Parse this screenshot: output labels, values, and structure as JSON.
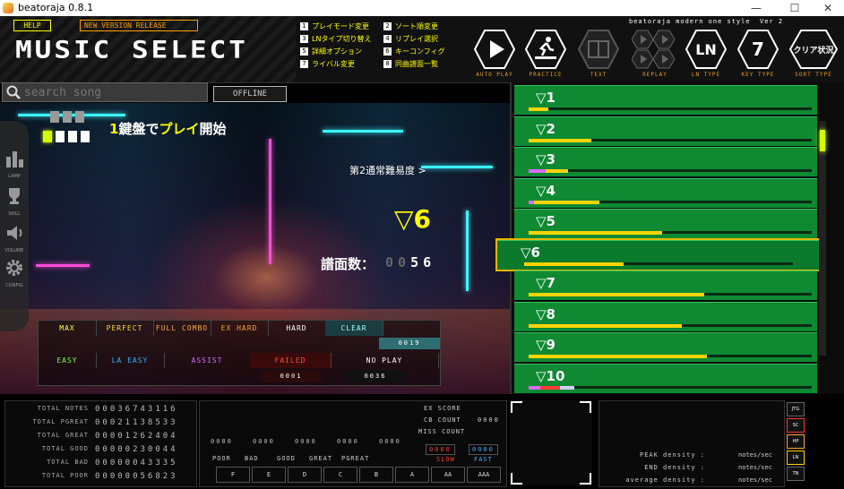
{
  "window": {
    "title": "beatoraja 0.8.1",
    "minimize": "—",
    "maximize": "☐",
    "close": "✕"
  },
  "header": {
    "help": "HELP",
    "new_version": "NEW VERSION RELEASE",
    "logo": "MUSIC SELECT",
    "skin_name": "beatoraja modern one style",
    "skin_version": "Ver 2",
    "key_hints": [
      {
        "key": "1",
        "label": "プレイモード変更"
      },
      {
        "key": "3",
        "label": "LNタイプ切り替え"
      },
      {
        "key": "5",
        "label": "詳細オプション"
      },
      {
        "key": "7",
        "label": "ライバル変更"
      },
      {
        "key": "2",
        "label": "ソート順変更"
      },
      {
        "key": "4",
        "label": "リプレイ選択"
      },
      {
        "key": "6",
        "label": "キーコンフィグ"
      },
      {
        "key": "8",
        "label": "同曲譜面一覧"
      }
    ],
    "buttons": [
      {
        "caption": "AUTO PLAY",
        "icon": "play-icon"
      },
      {
        "caption": "PRACTICE",
        "icon": "practice-runner-icon"
      },
      {
        "caption": "TEXT",
        "icon": "book-icon"
      },
      {
        "caption": "REPLAY",
        "icon": "replay-grid-icon"
      },
      {
        "caption": "LN TYPE",
        "icon": "ln-icon",
        "text": "LN"
      },
      {
        "caption": "KEY TYPE",
        "icon": "key-type-icon",
        "text": "7"
      },
      {
        "caption": "SORT TYPE",
        "icon": "clear-status-icon",
        "text": "クリア状況"
      }
    ]
  },
  "search": {
    "placeholder": "search song"
  },
  "offline": "OFFLINE",
  "sidebar": [
    {
      "caption": "LAMP",
      "icon": "bar-chart-icon"
    },
    {
      "caption": "SKILL",
      "icon": "trophy-icon"
    },
    {
      "caption": "VOLUME",
      "icon": "speaker-icon"
    },
    {
      "caption": "CONFIG",
      "icon": "gear-icon"
    }
  ],
  "selection": {
    "play_prefix": "1",
    "play_middle": "鍵盤で",
    "play_highlight": "プレイ",
    "play_suffix": "開始",
    "difficulty_name": "第2通常難易度 >",
    "level": "▽6",
    "notes_label": "譜面数：",
    "notes_dim": "00",
    "notes_bright": "56"
  },
  "lamps": {
    "row1": [
      "MAX",
      "PERFECT",
      "FULL COMBO",
      "EX HARD",
      "HARD",
      "CLEAR"
    ],
    "row1_colors": [
      "#ffff3a",
      "#ffd83a",
      "#ffa83a",
      "#ffa02a",
      "#ffffff",
      "#9fffff"
    ],
    "row2": [
      "EASY",
      "LA EASY",
      "ASSIST",
      "FAILED",
      "NO PLAY"
    ],
    "row2_colors": [
      "#7cff3a",
      "#3ab0ff",
      "#d86aff",
      "#ff4a3a",
      "#ffffff"
    ],
    "clear_count": "0019",
    "failed_count": "0001",
    "noplay_count": "0036"
  },
  "songs": [
    {
      "label": "▽1",
      "bar": [
        {
          "c": "#ffd400",
          "w": 0.07
        }
      ]
    },
    {
      "label": "▽2",
      "bar": [
        {
          "c": "#ffd400",
          "w": 0.22
        }
      ]
    },
    {
      "label": "▽3",
      "bar": [
        {
          "c": "#d86aff",
          "w": 0.06
        },
        {
          "c": "#ffd400",
          "w": 0.08
        }
      ]
    },
    {
      "label": "▽4",
      "bar": [
        {
          "c": "#d86aff",
          "w": 0.02
        },
        {
          "c": "#ffd400",
          "w": 0.23
        }
      ]
    },
    {
      "label": "▽5",
      "bar": [
        {
          "c": "#ffd400",
          "w": 0.47
        }
      ]
    },
    {
      "label": "▽6",
      "bar": [
        {
          "c": "#ffd400",
          "w": 0.37
        }
      ]
    },
    {
      "label": "▽7",
      "bar": [
        {
          "c": "#ffd400",
          "w": 0.62
        }
      ]
    },
    {
      "label": "▽8",
      "bar": [
        {
          "c": "#ffd400",
          "w": 0.54
        }
      ]
    },
    {
      "label": "▽9",
      "bar": [
        {
          "c": "#ffd400",
          "w": 0.63
        }
      ]
    },
    {
      "label": "▽10",
      "bar": [
        {
          "c": "#d86aff",
          "w": 0.04
        },
        {
          "c": "#ff3a3a",
          "w": 0.07
        },
        {
          "c": "#cfcfff",
          "w": 0.05
        }
      ]
    }
  ],
  "stats": [
    {
      "label": "TOTAL NOTES",
      "value": "00036743116"
    },
    {
      "label": "TOTAL PGREAT",
      "value": "00021138533"
    },
    {
      "label": "TOTAL GREAT",
      "value": "00001262404"
    },
    {
      "label": "TOTAL GOOD",
      "value": "00000230044"
    },
    {
      "label": "TOTAL BAD",
      "value": "00000043335"
    },
    {
      "label": "TOTAL POOR",
      "value": "00000056823"
    }
  ],
  "score": {
    "ex_score": "EX SCORE",
    "cb_count": "CB COUNT",
    "miss_count": "MISS COUNT",
    "cb_value": "0000",
    "miss_left": "0000",
    "miss_right": "0000",
    "slow": "SLOW",
    "fast": "FAST",
    "judge_values": [
      "0000",
      "0000",
      "0000",
      "0000",
      "0000"
    ],
    "judge_labels": [
      "POOR",
      "BAD",
      "GOOD",
      "GREAT",
      "PGREAT"
    ],
    "ranks": [
      "F",
      "E",
      "D",
      "C",
      "B",
      "A",
      "AA",
      "AAA"
    ]
  },
  "density": {
    "peak": "PEAK density :",
    "end": "END density :",
    "average": "average density :",
    "unit": "notes/sec",
    "tags": [
      "JTG",
      "SC",
      "HP",
      "LN",
      "TN"
    ]
  }
}
